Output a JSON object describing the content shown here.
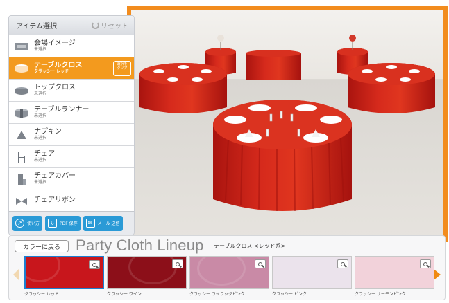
{
  "sidebar": {
    "title": "アイテム選択",
    "reset_label": "リセット",
    "items": [
      {
        "name": "会場イメージ",
        "status": "未選択",
        "icon": "venue-icon"
      },
      {
        "name": "テーブルクロス",
        "status": "クラッシー レッド",
        "icon": "tablecloth-icon",
        "detail_button": "選択を クリア"
      },
      {
        "name": "トップクロス",
        "status": "未選択",
        "icon": "topcloth-icon"
      },
      {
        "name": "テーブルランナー",
        "status": "未選択",
        "icon": "runner-icon"
      },
      {
        "name": "ナプキン",
        "status": "未選択",
        "icon": "napkin-icon"
      },
      {
        "name": "チェア",
        "status": "未選択",
        "icon": "chair-icon"
      },
      {
        "name": "チェアカバー",
        "status": "未選択",
        "icon": "chair-cover-icon"
      },
      {
        "name": "チェアリボン",
        "status": "",
        "icon": "ribbon-icon"
      }
    ],
    "footer": {
      "help_label": "使い方",
      "pdf_label": "PDF 保存",
      "mail_label": "メール 送信"
    }
  },
  "lineup": {
    "back_label": "カラーに戻る",
    "title": "Party Cloth Lineup",
    "subtitle": "テーブルクロス <レッド系>",
    "swatches": [
      {
        "name": "クラッシー レッド",
        "color": "#c8161c",
        "selected": true
      },
      {
        "name": "クラッシー ワイン",
        "color": "#8c0f19",
        "selected": false
      },
      {
        "name": "クラッシー ライラックピンク",
        "color": "#c98aa6",
        "selected": false
      },
      {
        "name": "クラッシー ピンク",
        "color": "#ebe3ec",
        "selected": false
      },
      {
        "name": "クラッシー サーモンピンク",
        "color": "#f2d2da",
        "selected": false
      }
    ]
  },
  "colors": {
    "accent": "#f28c1e",
    "footer_button": "#2a9ad6",
    "tablecloth": "#d42a1e"
  }
}
